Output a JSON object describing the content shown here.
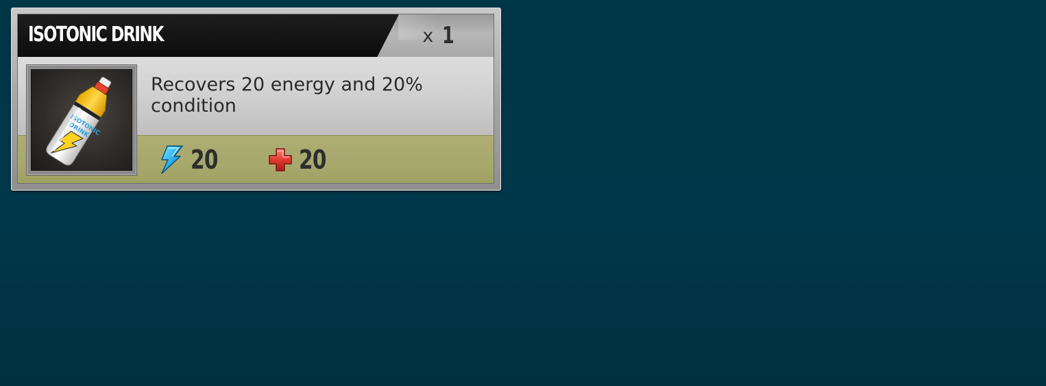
{
  "item": {
    "name": "ISOTONIC DRINK",
    "quantity_prefix": "x",
    "quantity": "1",
    "description": "Recovers 20 energy and 20% condition",
    "image_icon": "isotonic-drink-bottle-icon",
    "bottle_label": [
      "ISOTONIC",
      "DRINK"
    ]
  },
  "stats": {
    "energy": {
      "icon": "lightning-bolt-icon",
      "value": "20"
    },
    "condition": {
      "icon": "red-cross-icon",
      "value": "20"
    }
  },
  "colors": {
    "background": "#003747",
    "title_bar": "#111111",
    "stats_band": "#a8a86e",
    "energy_icon": "#29b6f6",
    "condition_icon": "#d83a3a"
  }
}
